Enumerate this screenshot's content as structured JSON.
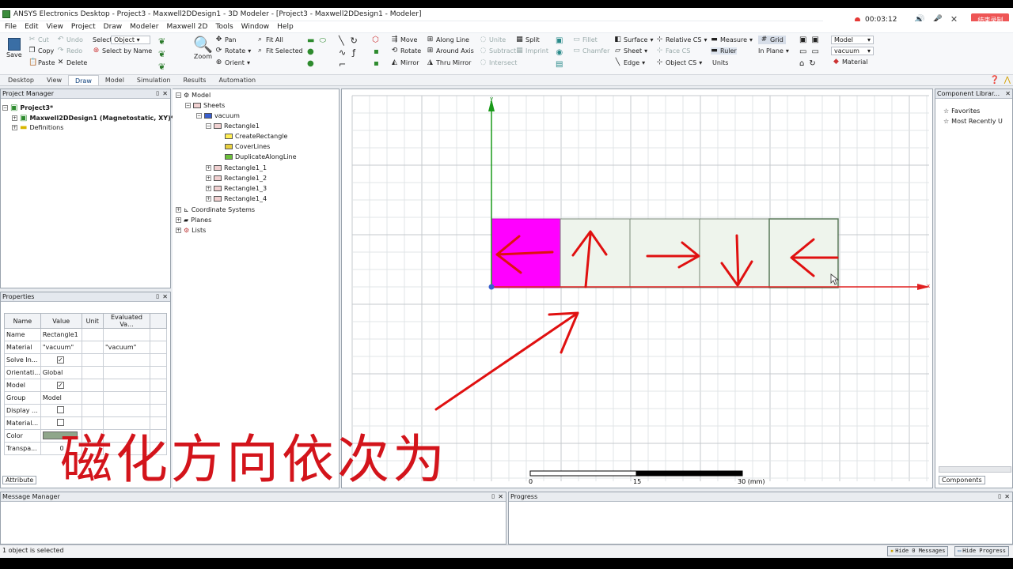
{
  "window": {
    "title": "ANSYS Electronics Desktop - Project3 - Maxwell2DDesign1 - 3D Modeler - [Project3 - Maxwell2DDesign1 - Modeler]"
  },
  "recorder": {
    "time": "00:03:12",
    "stop_label": "结束录制"
  },
  "menu": [
    "File",
    "Edit",
    "View",
    "Project",
    "Draw",
    "Modeler",
    "Maxwell 2D",
    "Tools",
    "Window",
    "Help"
  ],
  "ribbon": {
    "save": "Save",
    "cut": "Cut",
    "copy": "Copy",
    "paste": "Paste",
    "undo": "Undo",
    "redo": "Redo",
    "delete": "Delete",
    "select_label": "Select:",
    "select_value": "Object",
    "select_by_name": "Select by Name",
    "pan": "Pan",
    "rotate": "Rotate",
    "orient": "Orient",
    "zoom": "Zoom",
    "fit_all": "Fit All",
    "fit_selected": "Fit Selected",
    "move": "Move",
    "rotate2": "Rotate",
    "mirror": "Mirror",
    "along_line": "Along Line",
    "around_axis": "Around Axis",
    "thru_mirror": "Thru Mirror",
    "unite": "Unite",
    "subtract": "Subtract",
    "intersect": "Intersect",
    "split": "Split",
    "imprint": "Imprint",
    "fillet": "Fillet",
    "chamfer": "Chamfer",
    "surface": "Surface",
    "sheet": "Sheet",
    "edge": "Edge",
    "relative_cs": "Relative CS",
    "face_cs": "Face CS",
    "object_cs": "Object CS",
    "measure": "Measure",
    "ruler": "Ruler",
    "units": "Units",
    "grid": "Grid",
    "in_plane": "In Plane",
    "model_select": "Model",
    "material_select": "vacuum",
    "material": "Material"
  },
  "tabs": [
    "Desktop",
    "View",
    "Draw",
    "Model",
    "Simulation",
    "Results",
    "Automation"
  ],
  "project_manager": {
    "title": "Project Manager",
    "project": "Project3*",
    "design": "Maxwell2DDesign1 (Magnetostatic, XY)*",
    "definitions": "Definitions"
  },
  "model_tree": {
    "root": "Model",
    "sheets": "Sheets",
    "vacuum": "vacuum",
    "rect1": "Rectangle1",
    "ops": [
      "CreateRectangle",
      "CoverLines",
      "DuplicateAlongLine"
    ],
    "rects": [
      "Rectangle1_1",
      "Rectangle1_2",
      "Rectangle1_3",
      "Rectangle1_4"
    ],
    "others": [
      "Coordinate Systems",
      "Planes",
      "Lists"
    ]
  },
  "properties": {
    "title": "Properties",
    "headers": [
      "Name",
      "Value",
      "Unit",
      "Evaluated Va..."
    ],
    "rows": [
      {
        "name": "Name",
        "value": "Rectangle1",
        "eval": ""
      },
      {
        "name": "Material",
        "value": "\"vacuum\"",
        "eval": "\"vacuum\""
      },
      {
        "name": "Solve In...",
        "value": "",
        "eval": ""
      },
      {
        "name": "Orientati...",
        "value": "Global",
        "eval": ""
      },
      {
        "name": "Model",
        "value": "",
        "eval": ""
      },
      {
        "name": "Group",
        "value": "Model",
        "eval": ""
      },
      {
        "name": "Display ...",
        "value": "",
        "eval": ""
      },
      {
        "name": "Material...",
        "value": "",
        "eval": ""
      },
      {
        "name": "Color",
        "value": "",
        "eval": ""
      },
      {
        "name": "Transpa...",
        "value": "0",
        "eval": ""
      }
    ],
    "attribute_tab": "Attribute"
  },
  "component_library": {
    "title": "Component Librar...",
    "items": [
      "Favorites",
      "Most Recently U"
    ],
    "tab": "Components"
  },
  "viewport": {
    "axis_y": "y",
    "axis_x": "x",
    "scale_labels": [
      "0",
      "15",
      "30 (mm)"
    ],
    "caption": "磁化方向依次为",
    "colors": {
      "magenta": "#ff00ff",
      "grid": "#cfd3d6",
      "arrow": "#e01010",
      "yaxis": "#1a9a1a",
      "xaxis": "#e02020"
    }
  },
  "message_manager": {
    "title": "Message Manager"
  },
  "progress": {
    "title": "Progress"
  },
  "status": {
    "text": "1 object is selected",
    "hide_messages": "Hide 0 Messages",
    "hide_progress": "Hide Progress"
  }
}
